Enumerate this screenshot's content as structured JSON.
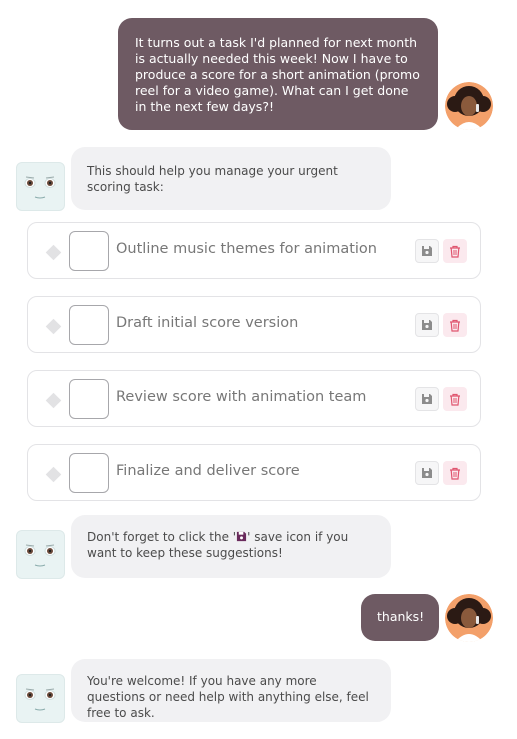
{
  "messages": {
    "user_1": "It turns out a task I'd planned for next month is actually needed this week! Now I have to produce a score for a short animation (promo reel for a video game). What can I get done in the next few days?!",
    "bot_1": "This should help you manage your urgent scoring task:",
    "bot_2_before": "Don't forget to click the '",
    "bot_2_after": "' save icon if you want to keep these suggestions!",
    "user_2": "thanks!",
    "bot_3": "You're welcome! If you have any more questions or need help with anything else, feel free to ask."
  },
  "tasks": [
    {
      "label": "Outline music themes for animation"
    },
    {
      "label": "Draft initial score version"
    },
    {
      "label": "Review score with animation team"
    },
    {
      "label": "Finalize and deliver score"
    }
  ],
  "icons": {
    "save": "floppy-disk-icon",
    "delete": "trash-icon",
    "drag": "drag-handle-icon"
  },
  "colors": {
    "user_bubble": "#6e5a63",
    "bot_bubble": "#f1f1f3",
    "delete_accent": "#e0556f"
  }
}
